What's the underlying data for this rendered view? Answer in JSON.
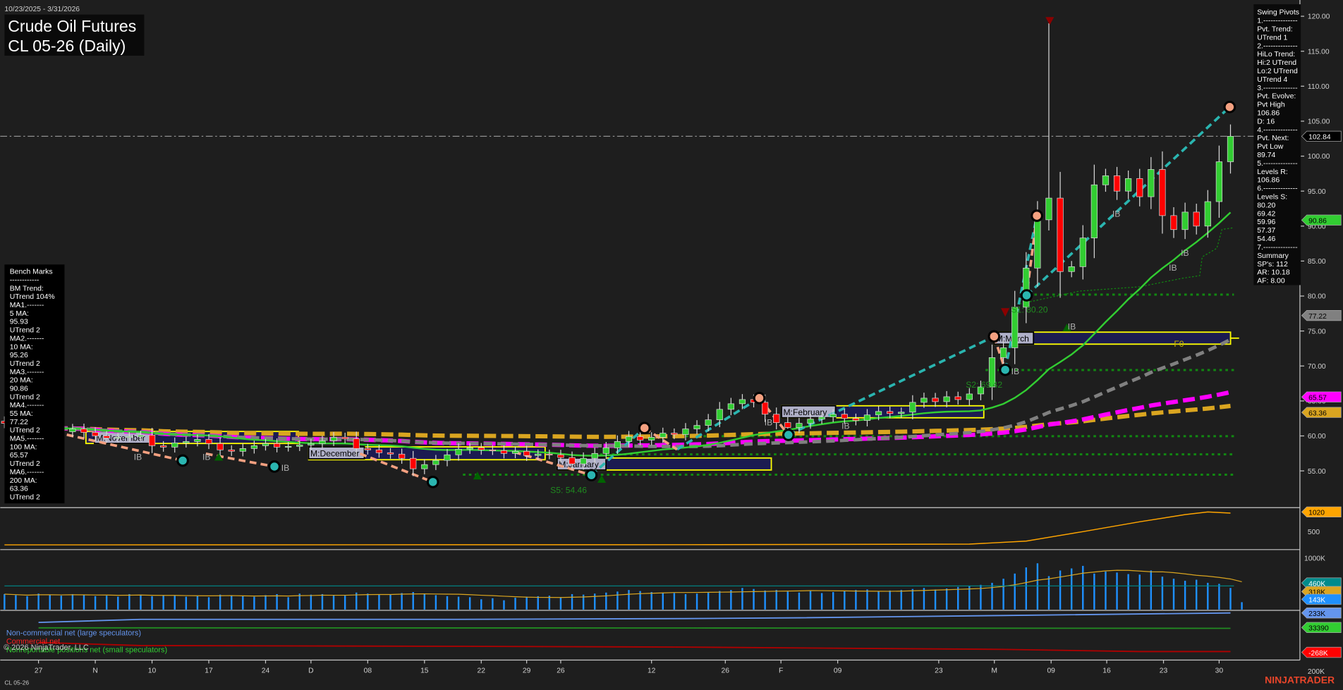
{
  "header": {
    "date_range": "10/23/2025 - 3/31/2026",
    "title": "Crude Oil Futures",
    "subtitle": "CL 05-26 (Daily)"
  },
  "bench_marks": {
    "lines": [
      "Bench Marks",
      "------------",
      "BM Trend:",
      "UTrend 104%",
      "MA1.-------",
      "5 MA:",
      "95.93",
      "UTrend 2",
      "MA2.-------",
      "10 MA:",
      "95.26",
      "UTrend 2",
      "MA3.-------",
      "20 MA:",
      "90.86",
      "UTrend 2",
      "MA4.-------",
      "55 MA:",
      "77.22",
      "UTrend 2",
      "MA5.-------",
      "100 MA:",
      "65.57",
      "UTrend 2",
      "MA6.-------",
      "200 MA:",
      "63.36",
      "UTrend 2"
    ]
  },
  "swing_pivots": {
    "lines": [
      "Swing Pivots",
      "1.--------------",
      "Pvt. Trend:",
      "UTrend 1",
      "2.--------------",
      "HiLo Trend:",
      "Hi:2 UTrend",
      "Lo:2 UTrend",
      "UTrend 4",
      "3.--------------",
      "Pvt. Evolve:",
      "Pvt High",
      "106.86",
      "D: 16",
      "4.--------------",
      "Pvt. Next:",
      "Pvt Low",
      "89.74",
      "5.--------------",
      "Levels R:",
      "106.86",
      "6.--------------",
      "Levels S:",
      "80.20",
      "69.42",
      "59.96",
      "57.37",
      "54.46",
      "7.--------------",
      "Summary",
      "SP's: 112",
      "AR: 10.18",
      "AF: 8.00"
    ]
  },
  "monthly_boxes": [
    "M:November",
    "M:December",
    "M:January",
    "M:February",
    "M:March"
  ],
  "annotations": {
    "s5": "S5: 54.46",
    "s2": "S2: 69.42",
    "s1": "S1: 80.20",
    "ib": "IB",
    "f0": "F0"
  },
  "price_axis": {
    "ticks": [
      120,
      115,
      110,
      105,
      100,
      95,
      90,
      85,
      80,
      75,
      70,
      65,
      60,
      55
    ],
    "tick_labels": [
      "120.00",
      "115.00",
      "110.00",
      "105.00",
      "100.00",
      "95.00",
      "90.00",
      "85.00",
      "80.00",
      "75.00",
      "70.00",
      "65.00",
      "60.00",
      "55.00"
    ],
    "tags": [
      {
        "label": "102.84",
        "value": 102.84,
        "color": "#000000",
        "text": "#ffffff"
      },
      {
        "label": "90.86",
        "value": 90.86,
        "color": "#32cd32",
        "text": "#000000"
      },
      {
        "label": "77.22",
        "value": 77.22,
        "color": "#808080",
        "text": "#000000"
      },
      {
        "label": "65.57",
        "value": 65.57,
        "color": "#ff00ff",
        "text": "#000000"
      },
      {
        "label": "63.36",
        "value": 63.36,
        "color": "#daa520",
        "text": "#000000"
      }
    ]
  },
  "open_interest_axis": {
    "ticks": [
      "500"
    ],
    "tag": {
      "label": "1020",
      "color": "#ffa500"
    }
  },
  "volume_axis": {
    "ticks": [
      "1000K"
    ],
    "tags": [
      {
        "label": "460K",
        "color": "#008b8b",
        "text": "#ffffff",
        "value": 460
      },
      {
        "label": "318K",
        "color": "#daa520",
        "text": "#000000",
        "value": 318
      },
      {
        "label": "143K",
        "color": "#1e90ff",
        "text": "#ffffff",
        "value": 143
      }
    ]
  },
  "cot_axis": {
    "ticks": [
      "200K"
    ],
    "tags": [
      {
        "label": "233K",
        "color": "#6495ed",
        "text": "#000000",
        "value": 233
      },
      {
        "label": "33390",
        "color": "#32cd32",
        "text": "#000000",
        "value": 33.39
      },
      {
        "label": "-268K",
        "color": "#ff0000",
        "text": "#ffffff",
        "value": -268
      }
    ]
  },
  "cot_legend": {
    "noncommercial": "Non-commercial net (large speculators)",
    "commercial": "Commercial net",
    "nonreportable": "Nonreportable positions net (small speculators)"
  },
  "copyright": "© 2026 NinjaTrader, LLC",
  "x_axis": {
    "labels": [
      {
        "text": "27",
        "bar": 3
      },
      {
        "text": "N",
        "bar": 8
      },
      {
        "text": "10",
        "bar": 13
      },
      {
        "text": "17",
        "bar": 18
      },
      {
        "text": "24",
        "bar": 23
      },
      {
        "text": "D",
        "bar": 27
      },
      {
        "text": "08",
        "bar": 32
      },
      {
        "text": "15",
        "bar": 37
      },
      {
        "text": "22",
        "bar": 42
      },
      {
        "text": "29",
        "bar": 46
      },
      {
        "text": "26",
        "bar": 49
      },
      {
        "text": "12",
        "bar": 57
      },
      {
        "text": "26",
        "bar": 63.5
      },
      {
        "text": "F",
        "bar": 68.4
      },
      {
        "text": "09",
        "bar": 73.4
      },
      {
        "text": "23",
        "bar": 82.3
      },
      {
        "text": "M",
        "bar": 87.2
      },
      {
        "text": "09",
        "bar": 92.2
      },
      {
        "text": "16",
        "bar": 97.1
      },
      {
        "text": "23",
        "bar": 102.1
      },
      {
        "text": "30",
        "bar": 107
      }
    ]
  },
  "footer": {
    "instrument": "CL 05-26",
    "brand": "NINJATRADER"
  },
  "chart_data": {
    "type": "candlestick",
    "title": "Crude Oil Futures CL 05-26 (Daily)",
    "ylim": [
      52,
      121
    ],
    "close": [
      61.8,
      61.5,
      61.3,
      60.5,
      60.8,
      60.6,
      61.0,
      60.5,
      60.0,
      59.7,
      59.8,
      59.9,
      60.1,
      58.6,
      58.4,
      59.0,
      59.2,
      59.5,
      58.9,
      58.0,
      57.8,
      58.2,
      58.6,
      58.9,
      58.4,
      58.5,
      58.7,
      58.9,
      59.3,
      59.8,
      59.6,
      58.2,
      58.0,
      57.6,
      57.4,
      56.8,
      55.3,
      55.9,
      56.5,
      57.3,
      58.1,
      58.3,
      58.0,
      57.9,
      57.5,
      57.8,
      57.2,
      57.4,
      57.3,
      56.9,
      56.0,
      56.8,
      57.5,
      58.3,
      59.2,
      59.9,
      59.4,
      59.8,
      60.4,
      60.2,
      61.0,
      61.5,
      62.3,
      63.8,
      64.6,
      65.2,
      64.8,
      63.1,
      61.9,
      61.2,
      61.8,
      62.4,
      62.7,
      63.1,
      62.5,
      62.2,
      63.0,
      63.5,
      63.2,
      63.4,
      64.8,
      65.4,
      64.9,
      65.6,
      65.2,
      66.0,
      67.0,
      71.2,
      72.6,
      78.4,
      84.0,
      90.9,
      94.0,
      83.5,
      84.2,
      88.3,
      95.9,
      97.2,
      95.0,
      96.8,
      94.2,
      98.1,
      91.5,
      89.5,
      92.0,
      90.0,
      93.5,
      99.2,
      102.84
    ],
    "spike": {
      "bar": 92,
      "high": 119.0
    },
    "moving_averages": {
      "ma20_last": 90.86,
      "ma55_last": 77.22,
      "ma100_last": 65.57,
      "ma200_last": 63.36
    },
    "support_levels": [
      80.2,
      69.42,
      59.96,
      57.37,
      54.46
    ],
    "resistance_level": 106.86,
    "last_price": 102.84,
    "volume_k": [
      300,
      280,
      260,
      310,
      290,
      270,
      300,
      280,
      260,
      270,
      250,
      300,
      290,
      260,
      280,
      270,
      250,
      260,
      240,
      290,
      270,
      260,
      250,
      280,
      300,
      240,
      310,
      290,
      300,
      280,
      270,
      330,
      310,
      300,
      290,
      320,
      340,
      300,
      280,
      260,
      250,
      240,
      200,
      220,
      180,
      230,
      250,
      260,
      270,
      240,
      300,
      290,
      310,
      330,
      350,
      380,
      360,
      340,
      330,
      320,
      300,
      310,
      330,
      360,
      380,
      420,
      400,
      370,
      380,
      350,
      330,
      360,
      320,
      340,
      360,
      380,
      390,
      350,
      370,
      380,
      400,
      420,
      390,
      410,
      440,
      460,
      480,
      520,
      600,
      700,
      820,
      900,
      650,
      760,
      800,
      850,
      700,
      740,
      720,
      690,
      680,
      760,
      640,
      600,
      560,
      580,
      520,
      500,
      420,
      143
    ],
    "open_interest": [
      [
        0,
        150
      ],
      [
        60,
        155
      ],
      [
        85,
        170
      ],
      [
        90,
        250
      ],
      [
        95,
        500
      ],
      [
        100,
        760
      ],
      [
        104,
        950
      ],
      [
        106,
        1020
      ],
      [
        108,
        990
      ]
    ],
    "cot_k": {
      "noncommercial": [
        [
          3,
          110
        ],
        [
          12,
          150
        ],
        [
          40,
          150
        ],
        [
          60,
          160
        ],
        [
          70,
          170
        ],
        [
          88,
          200
        ],
        [
          108,
          233
        ]
      ],
      "commercial": [
        [
          3,
          -150
        ],
        [
          12,
          -190
        ],
        [
          40,
          -200
        ],
        [
          60,
          -210
        ],
        [
          88,
          -240
        ],
        [
          100,
          -268
        ],
        [
          108,
          -268
        ]
      ],
      "nonreportable": [
        [
          3,
          40
        ],
        [
          60,
          38
        ],
        [
          108,
          33.39
        ]
      ]
    }
  }
}
